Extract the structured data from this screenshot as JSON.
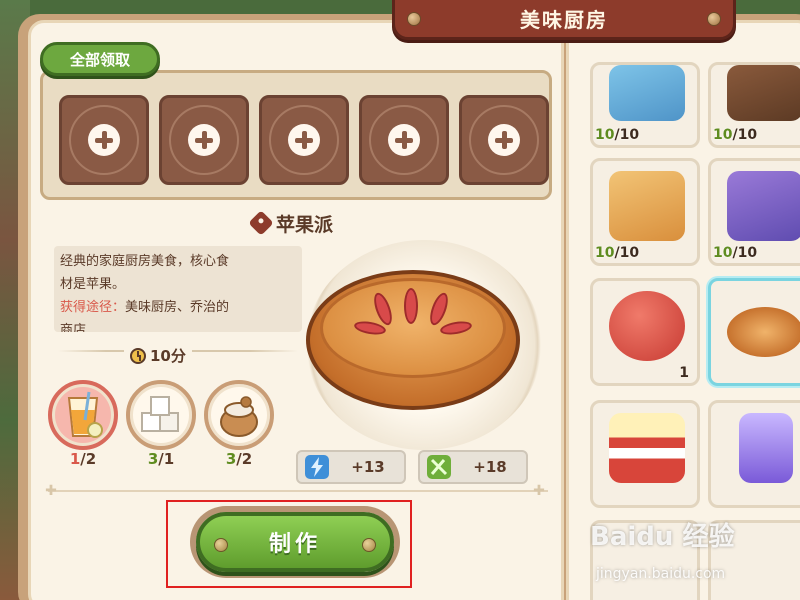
{
  "window": {
    "title": "美味厨房"
  },
  "actions": {
    "claim_all": "全部领取",
    "make": "制作"
  },
  "recipe": {
    "name": "苹果派",
    "description_line1": "经典的家庭厨房美食，核心食",
    "description_line2": "材是苹果。",
    "source_label": "获得途径：",
    "source_value_line1": "美味厨房、乔治的",
    "source_value_line2": "商店",
    "time": "10分",
    "ingredients": [
      {
        "icon": "apple-juice-icon",
        "have": "1",
        "need": "/2",
        "lacking": true
      },
      {
        "icon": "sugar-cubes-icon",
        "have": "3",
        "need": "/1",
        "lacking": false
      },
      {
        "icon": "flour-sack-icon",
        "have": "3",
        "need": "/2",
        "lacking": false
      }
    ],
    "stats": {
      "energy": "+13",
      "food": "+18"
    }
  },
  "items": [
    {
      "name": "chips-bag-yellow",
      "have": "10",
      "cap": "/10"
    },
    {
      "name": "chips-bag-brown",
      "have": "10",
      "cap": "/10"
    },
    {
      "name": "snack-bag-seal",
      "have": "10",
      "cap": "/10"
    },
    {
      "name": "snack-bag-hamster",
      "have": "10",
      "cap": "/10"
    },
    {
      "name": "jam-jar",
      "count": "1"
    },
    {
      "name": "apple-pie",
      "selected": true
    },
    {
      "name": "popcorn-bucket"
    },
    {
      "name": "grape-juice-cup"
    }
  ],
  "watermark": {
    "brand": "Baidu 经验",
    "url": "jingyan.baidu.com"
  },
  "colors": {
    "accent_green": "#6da83f",
    "banner_red": "#8d3b2b",
    "lack_red": "#d9584a",
    "selected_cyan": "#7ad4e0"
  }
}
